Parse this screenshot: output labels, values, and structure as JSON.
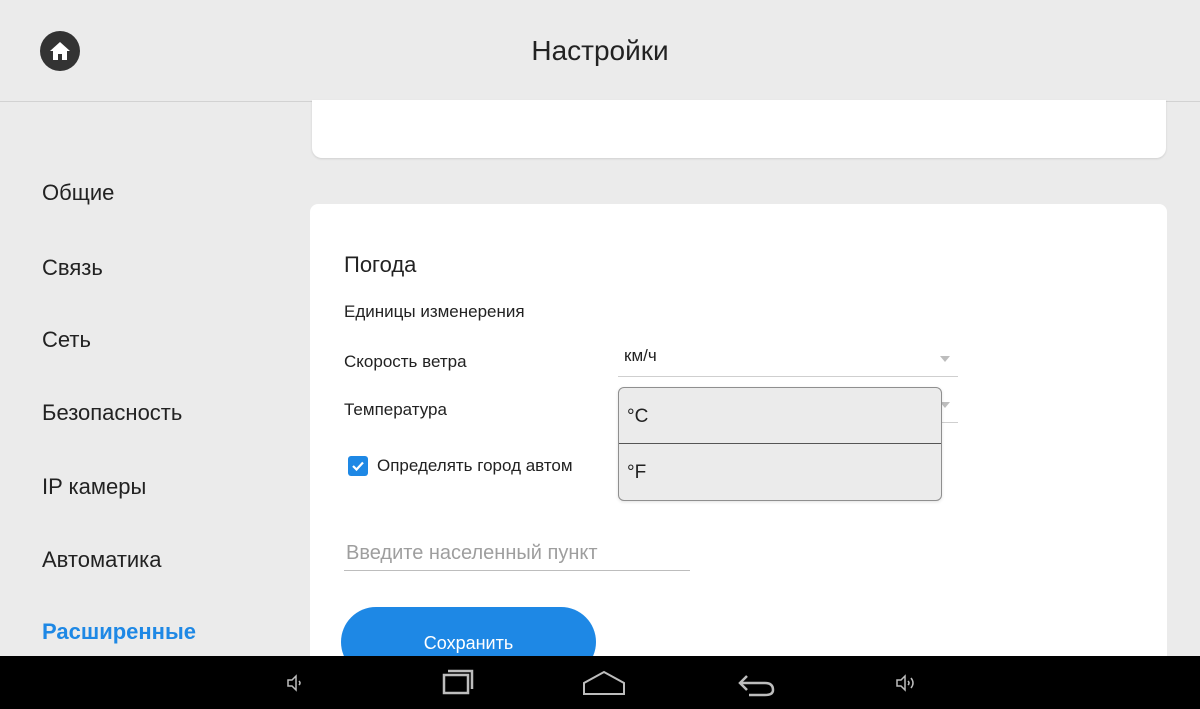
{
  "header": {
    "title": "Настройки",
    "home_icon": "home-icon"
  },
  "sidebar": {
    "items": [
      {
        "label": "Общие",
        "active": false
      },
      {
        "label": "Связь",
        "active": false
      },
      {
        "label": "Сеть",
        "active": false
      },
      {
        "label": "Безопасность",
        "active": false
      },
      {
        "label": "IP камеры",
        "active": false
      },
      {
        "label": "Автоматика",
        "active": false
      },
      {
        "label": "Расширенные",
        "active": true
      }
    ]
  },
  "weather": {
    "section_title": "Погода",
    "units_label": "Единицы изменерения",
    "wind_speed": {
      "label": "Скорость ветра",
      "value": "км/ч"
    },
    "temperature": {
      "label": "Температура",
      "options": [
        "°C",
        "°F"
      ]
    },
    "auto_city": {
      "label": "Определять город автом",
      "checked": true
    },
    "city_input": {
      "placeholder": "Введите населенный пункт",
      "value": ""
    },
    "save_label": "Сохранить"
  },
  "navbar": {
    "icons": [
      "volume-down-icon",
      "recent-apps-icon",
      "home-nav-icon",
      "back-icon",
      "volume-up-icon"
    ]
  },
  "colors": {
    "accent": "#1e88e5",
    "background": "#ebebeb",
    "navbar": "#000000"
  }
}
